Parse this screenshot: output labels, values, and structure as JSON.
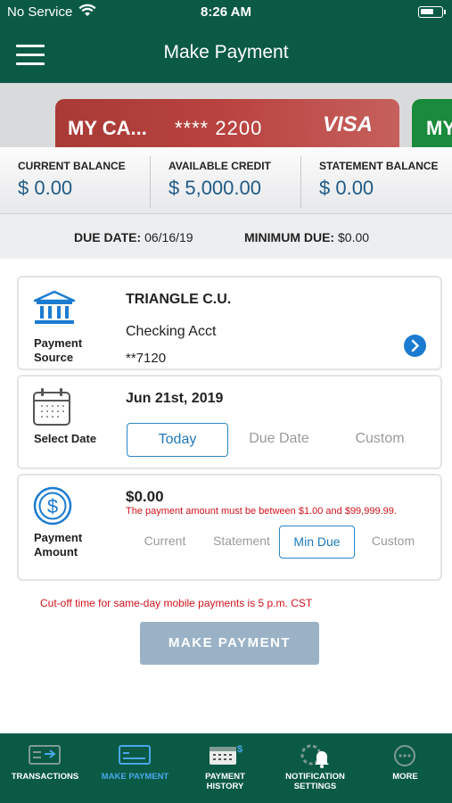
{
  "status_bar": {
    "carrier": "No Service",
    "time": "8:26 AM"
  },
  "header": {
    "title": "Make Payment"
  },
  "cards": [
    {
      "name": "MY CA...",
      "number": "**** 2200",
      "brand": "VISA",
      "color": "#b6413d"
    },
    {
      "name": "MY",
      "color": "#1a8a3c"
    }
  ],
  "balances": [
    {
      "label": "CURRENT BALANCE",
      "value": "$ 0.00"
    },
    {
      "label": "AVAILABLE CREDIT",
      "value": "$ 5,000.00"
    },
    {
      "label": "STATEMENT BALANCE",
      "value": "$ 0.00"
    }
  ],
  "due": {
    "due_date_label": "DUE DATE:",
    "due_date": "06/16/19",
    "min_due_label": "MINIMUM DUE:",
    "min_due": "$0.00"
  },
  "payment_source": {
    "label_line1": "Payment",
    "label_line2": "Source",
    "bank": "TRIANGLE C.U.",
    "account": "Checking Acct",
    "account_number": "**7120"
  },
  "select_date": {
    "label": "Select Date",
    "date": "Jun 21st, 2019",
    "options": [
      "Today",
      "Due Date",
      "Custom"
    ],
    "selected": "Today"
  },
  "payment_amount": {
    "label_line1": "Payment",
    "label_line2": "Amount",
    "amount": "$0.00",
    "warning": "The payment amount must be between $1.00 and $99,999.99.",
    "options": [
      "Current",
      "Statement",
      "Min Due",
      "Custom"
    ],
    "selected": "Min Due"
  },
  "cutoff_note": "Cut-off time for same-day mobile payments is 5 p.m. CST",
  "make_payment_button": "MAKE PAYMENT",
  "tabs": [
    {
      "line1": "TRANSACTIONS",
      "line2": "",
      "icon": "transactions-icon"
    },
    {
      "line1": "MAKE PAYMENT",
      "line2": "",
      "icon": "card-payment-icon",
      "active": true
    },
    {
      "line1": "PAYMENT",
      "line2": "HISTORY",
      "icon": "calendar-dollar-icon"
    },
    {
      "line1": "NOTIFICATION",
      "line2": "SETTINGS",
      "icon": "bell-gear-icon"
    },
    {
      "line1": "MORE",
      "line2": "",
      "icon": "more-icon"
    }
  ],
  "colors": {
    "brand_green": "#0b5a45",
    "balance_blue": "#1f5a86",
    "accent_blue": "#2a86c4",
    "error_red": "#d0121b",
    "button_disabled": "#9bb2c6"
  }
}
